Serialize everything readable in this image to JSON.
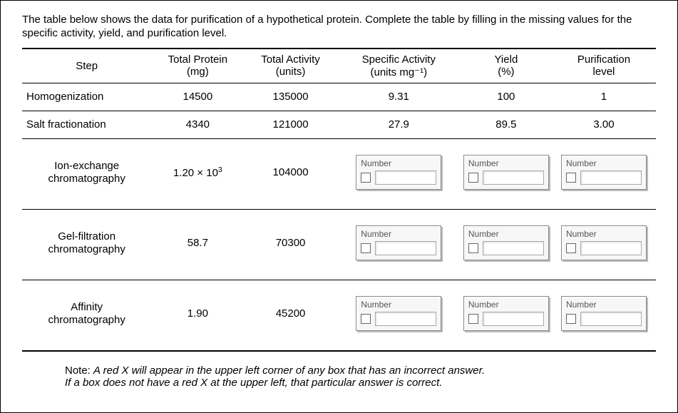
{
  "prompt": "The table below shows the data for purification of a hypothetical protein. Complete the table by filling in the missing values for the specific activity, yield, and purification level.",
  "columns": {
    "step": "Step",
    "total_protein": "Total Protein",
    "total_protein_unit": "(mg)",
    "total_activity": "Total Activity",
    "total_activity_unit": "(units)",
    "specific_activity": "Specific Activity",
    "specific_activity_unit": "(units mg⁻¹)",
    "yield": "Yield",
    "yield_unit": "(%)",
    "purification": "Purification",
    "purification_sub": "level"
  },
  "answerbox_label": "Number",
  "rows": [
    {
      "step_line": "Homogenization",
      "total_protein": "14500",
      "total_activity": "135000",
      "specific_activity": "9.31",
      "yield": "100",
      "purification": "1",
      "has_inputs": false
    },
    {
      "step_line": "Salt fractionation",
      "total_protein": "4340",
      "total_activity": "121000",
      "specific_activity": "27.9",
      "yield": "89.5",
      "purification": "3.00",
      "has_inputs": false
    },
    {
      "step_line1": "Ion-exchange",
      "step_line2": "chromatography",
      "total_protein_html": "1.20 × 10<sup>3</sup>",
      "total_activity": "104000",
      "has_inputs": true
    },
    {
      "step_line1": "Gel-filtration",
      "step_line2": "chromatography",
      "total_protein": "58.7",
      "total_activity": "70300",
      "has_inputs": true
    },
    {
      "step_line1": "Affinity",
      "step_line2": "chromatography",
      "total_protein": "1.90",
      "total_activity": "45200",
      "has_inputs": true
    }
  ],
  "note_prefix": "Note: ",
  "note_line1": "A red X will appear in the upper left corner of any box that has an incorrect answer.",
  "note_line2": "If a box does not have a red X at the upper left, that particular answer is correct."
}
